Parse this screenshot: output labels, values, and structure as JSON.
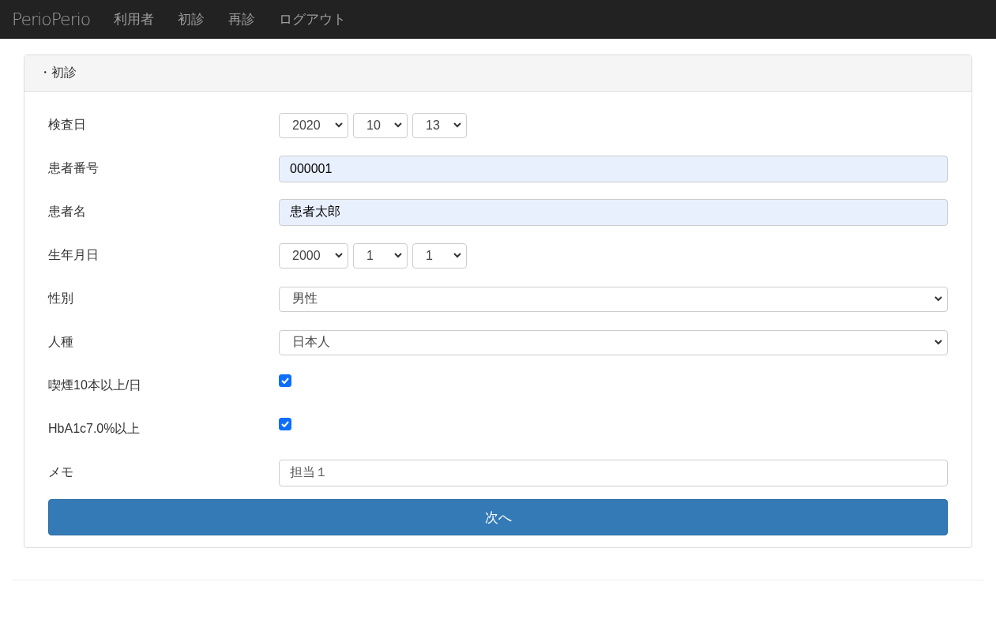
{
  "navbar": {
    "brand": "PerioPerio",
    "links": [
      "利用者",
      "初診",
      "再診",
      "ログアウト"
    ]
  },
  "panel": {
    "title": "・初診",
    "fields": [
      {
        "kind": "date",
        "label": "検査日",
        "values": [
          "2020",
          "10",
          "13"
        ]
      },
      {
        "kind": "text",
        "label": "患者番号",
        "value": "000001",
        "autofilled": true
      },
      {
        "kind": "text",
        "label": "患者名",
        "value": "患者太郎",
        "autofilled": true
      },
      {
        "kind": "date",
        "label": "生年月日",
        "values": [
          "2000",
          "1",
          "1"
        ]
      },
      {
        "kind": "select",
        "label": "性別",
        "value": "男性"
      },
      {
        "kind": "select",
        "label": "人種",
        "value": "日本人"
      },
      {
        "kind": "checkbox",
        "label": "喫煙10本以上/日",
        "checked": true
      },
      {
        "kind": "checkbox",
        "label": "HbA1c7.0%以上",
        "checked": true
      },
      {
        "kind": "text",
        "label": "メモ",
        "value": "担当１",
        "autofilled": false
      }
    ],
    "submit": "次へ"
  }
}
